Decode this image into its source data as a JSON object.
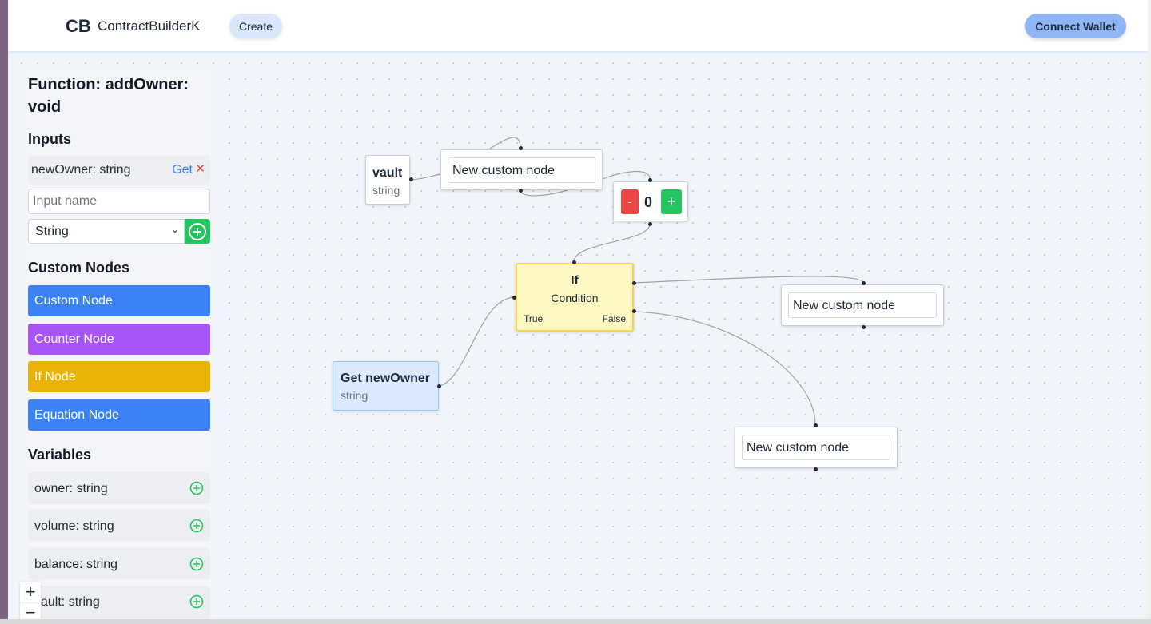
{
  "header": {
    "logo": "CB",
    "brand": "ContractBuilderK",
    "create_label": "Create",
    "wallet_label": "Connect Wallet"
  },
  "sidebar": {
    "function_title": "Function: addOwner: void",
    "inputs_heading": "Inputs",
    "inputs": [
      {
        "label": "newOwner: string",
        "get_label": "Get",
        "remove_icon": "close-icon"
      }
    ],
    "input_name_placeholder": "Input name",
    "type_select_value": "String",
    "custom_nodes_heading": "Custom Nodes",
    "custom_nodes": [
      {
        "label": "Custom Node",
        "color": "#3b82f6"
      },
      {
        "label": "Counter Node",
        "color": "#a855f7"
      },
      {
        "label": "If Node",
        "color": "#eab308"
      },
      {
        "label": "Equation Node",
        "color": "#3b82f6"
      }
    ],
    "variables_heading": "Variables",
    "variables": [
      {
        "label": "owner: string"
      },
      {
        "label": "volume: string"
      },
      {
        "label": "balance: string"
      },
      {
        "label": "vault: string"
      }
    ]
  },
  "zoom_controls": {
    "in": "+",
    "out": "−"
  },
  "canvas": {
    "vault_node": {
      "title": "vault",
      "type": "string"
    },
    "custom_nodes": [
      "New custom node",
      "New custom node",
      "New custom node"
    ],
    "counter_node": {
      "minus": "-",
      "value": "0",
      "plus": "+"
    },
    "if_node": {
      "title": "If",
      "condition": "Condition",
      "true_label": "True",
      "false_label": "False"
    },
    "get_node": {
      "title": "Get newOwner",
      "type": "string"
    }
  }
}
